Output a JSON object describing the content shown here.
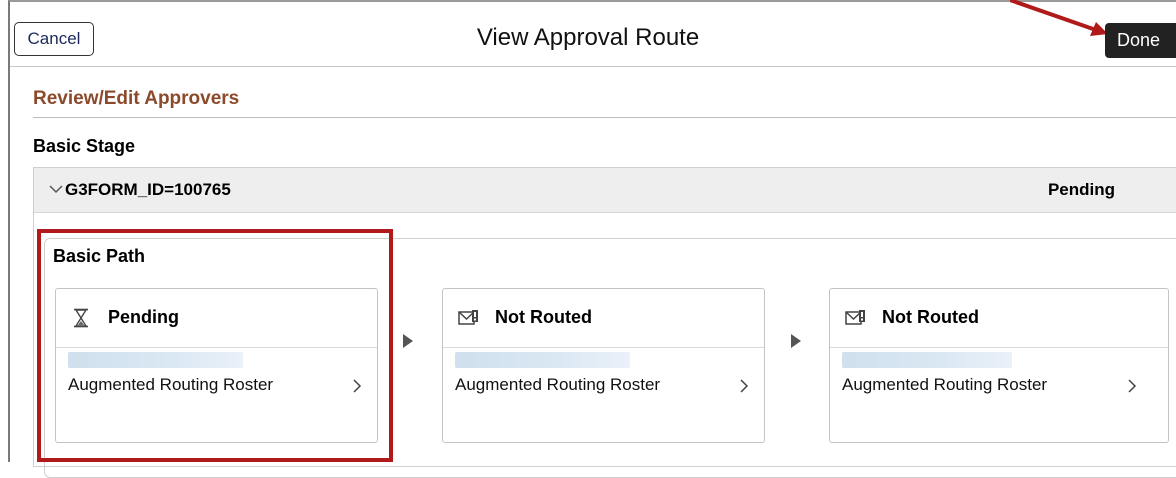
{
  "header": {
    "cancel_label": "Cancel",
    "title": "View Approval Route",
    "done_label": "Done"
  },
  "section": {
    "title": "Review/Edit Approvers",
    "stage_title": "Basic Stage"
  },
  "group": {
    "id_label": "G3FORM_ID=100765",
    "status": "Pending"
  },
  "path": {
    "title": "Basic Path",
    "steps": [
      {
        "icon": "hourglass-icon",
        "status": "Pending",
        "roster": "Augmented Routing Roster"
      },
      {
        "icon": "not-routed-icon",
        "status": "Not Routed",
        "roster": "Augmented Routing Roster"
      },
      {
        "icon": "not-routed-icon",
        "status": "Not Routed",
        "roster": "Augmented Routing Roster"
      }
    ]
  },
  "colors": {
    "section_title": "#8b4a2b",
    "highlight": "#b01a1a",
    "annotation_arrow": "#b01a1a",
    "done_bg": "#222222"
  }
}
